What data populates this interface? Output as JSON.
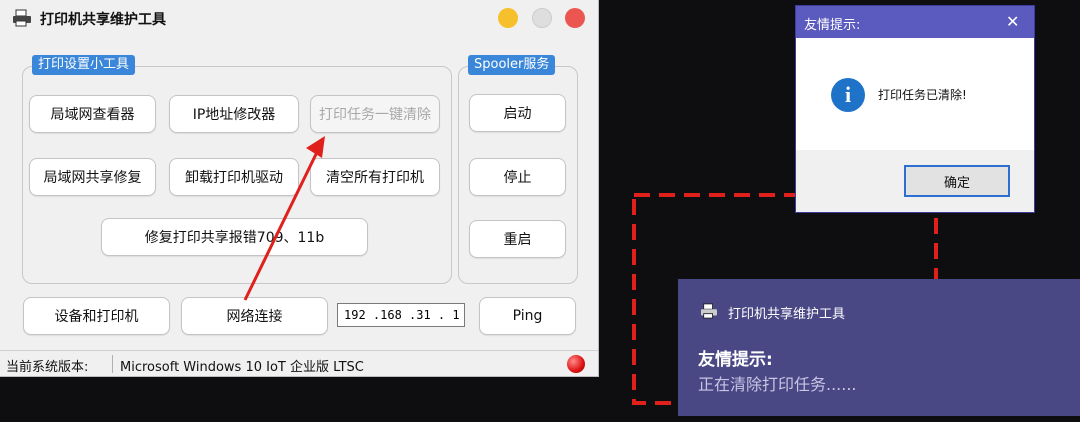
{
  "main_window": {
    "title": "打印机共享维护工具",
    "group_tools_label": "打印设置小工具",
    "group_spooler_label": "Spooler服务",
    "buttons": {
      "lan_viewer": "局域网查看器",
      "ip_modifier": "IP地址修改器",
      "clear_jobs": "打印任务一键清除",
      "lan_share_repair": "局域网共享修复",
      "uninstall_driver": "卸载打印机驱动",
      "clear_printers": "清空所有打印机",
      "repair_share_error": "修复打印共享报错709、11b",
      "start": "启动",
      "stop": "停止",
      "restart": "重启",
      "devices_printers": "设备和打印机",
      "network_connect": "网络连接",
      "ping": "Ping"
    },
    "ip_value": "192 .168 .31  . 1",
    "status": {
      "label": "当前系统版本:",
      "value": "Microsoft Windows 10 IoT 企业版 LTSC"
    }
  },
  "dialog": {
    "title": "友情提示:",
    "message": "打印任务已清除!",
    "ok_label": "确定",
    "icon": "info-icon"
  },
  "toast": {
    "app_name": "打印机共享维护工具",
    "title": "友情提示:",
    "body": "正在清除打印任务......"
  },
  "colors": {
    "accent_blue": "#3a86d8",
    "annotation_red": "#e0201a",
    "toast_bg": "#4a4785",
    "dialog_title_bg": "#5a5abf"
  }
}
